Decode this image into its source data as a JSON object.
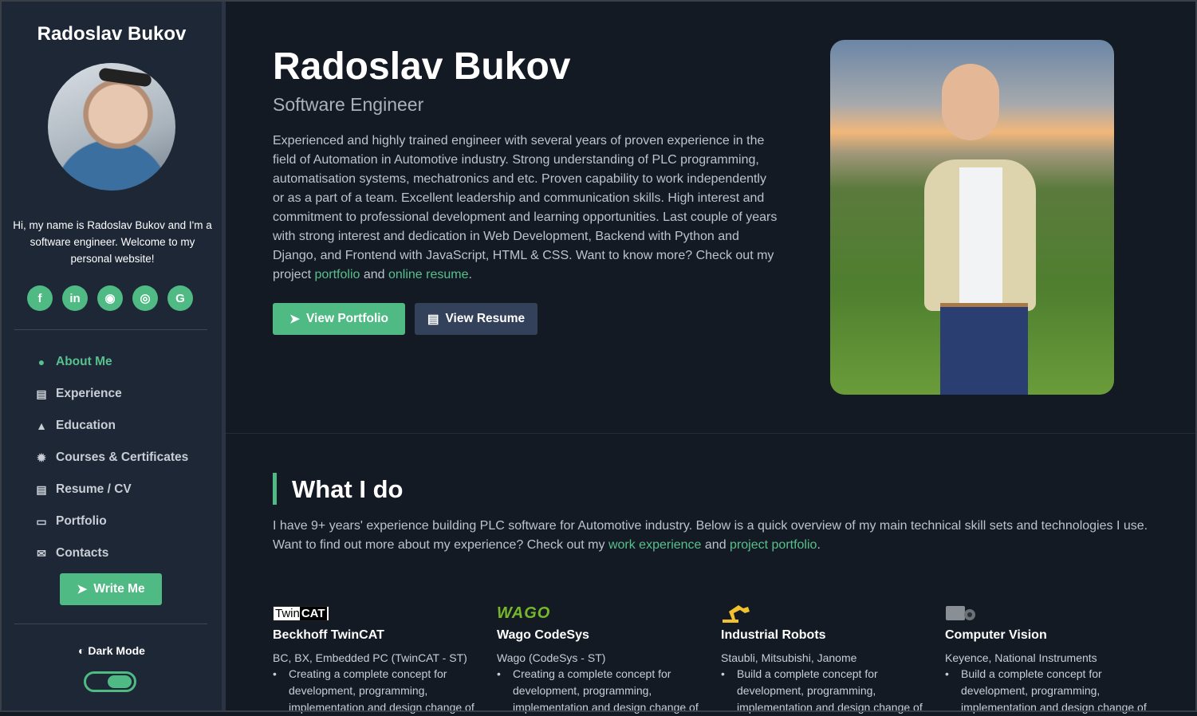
{
  "sidebar": {
    "brand": "Radoslav Bukov",
    "bio": "Hi, my name is Radoslav Bukov and I'm a software engineer. Welcome to my personal website!",
    "socials": [
      {
        "icon": "facebook-icon",
        "glyph": "f"
      },
      {
        "icon": "linkedin-icon",
        "glyph": "in"
      },
      {
        "icon": "github-icon",
        "glyph": "◉"
      },
      {
        "icon": "instagram-icon",
        "glyph": "◎"
      },
      {
        "icon": "google-icon",
        "glyph": "G"
      }
    ],
    "nav": [
      {
        "label": "About Me",
        "icon": "user-icon",
        "glyph": "👤",
        "active": true
      },
      {
        "label": "Experience",
        "icon": "briefcase-icon",
        "glyph": "💼",
        "active": false
      },
      {
        "label": "Education",
        "icon": "graduation-cap-icon",
        "glyph": "🎓",
        "active": false
      },
      {
        "label": "Courses & Certificates",
        "icon": "certificate-icon",
        "glyph": "✹",
        "active": false
      },
      {
        "label": "Resume / CV",
        "icon": "file-icon",
        "glyph": "▤",
        "active": false
      },
      {
        "label": "Portfolio",
        "icon": "laptop-icon",
        "glyph": "▭",
        "active": false
      },
      {
        "label": "Contacts",
        "icon": "mailbox-icon",
        "glyph": "✉",
        "active": false
      }
    ],
    "write_me_label": "Write Me",
    "dark_mode_label": "Dark Mode",
    "dark_mode_on": true
  },
  "hero": {
    "name": "Radoslav Bukov",
    "role": "Software Engineer",
    "description_parts": [
      "Experienced and highly trained engineer with several years of proven experience in the field of Automation in Automotive industry. Strong understanding of PLC programming, automatisation systems, mechatronics and etc. Proven capability to work independently or as a part of a team. Excellent leadership and communication skills. High interest and commitment to professional development and learning opportunities. Last couple of years with strong interest and dedication in Web Development, Backend with Python and Django, and Frontend with JavaScript, HTML & CSS. Want to know more? Check out my project ",
      "portfolio",
      " and ",
      "online resume",
      "."
    ],
    "view_portfolio_label": "View Portfolio",
    "view_resume_label": "View Resume"
  },
  "what_i_do": {
    "title": "What I do",
    "intro_parts": [
      "I have 9+ years' experience building PLC software for Automotive industry. Below is a quick overview of my main technical skill sets and technologies I use. Want to find out more about my experience? Check out my ",
      "work experience",
      " and ",
      "project portfolio",
      "."
    ],
    "skills": [
      {
        "title": "Beckhoff TwinCAT",
        "tech": "BC, BX, Embedded PC (TwinCAT - ST)",
        "bullet": "Creating a complete concept for development, programming, implementation and design change of"
      },
      {
        "title": "Wago CodeSys",
        "tech": "Wago (CodeSys - ST)",
        "bullet": "Creating a complete concept for development, programming, implementation and design change of"
      },
      {
        "title": "Industrial Robots",
        "tech": "Staubli, Mitsubishi, Janome",
        "bullet": "Build a complete concept for development, programming, implementation and design change of"
      },
      {
        "title": "Computer Vision",
        "tech": "Keyence, National Instruments",
        "bullet": "Build a complete concept for development, programming, implementation and design change of"
      }
    ],
    "logos": {
      "twincat_a": "Twin",
      "twincat_b": "CAT",
      "wago": "WAGO"
    }
  },
  "colors": {
    "accent": "#4fba84",
    "sidebar": "#1d2736",
    "background": "#141a23"
  }
}
